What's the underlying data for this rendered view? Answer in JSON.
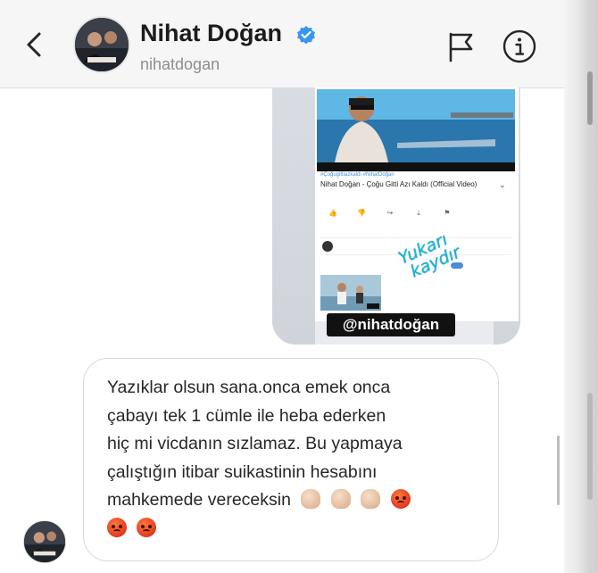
{
  "header": {
    "name": "Nihat Doğan",
    "handle": "nihatdogan",
    "verified": true,
    "icons": [
      "back-arrow-icon",
      "flag-icon",
      "info-icon",
      "verified-badge-icon"
    ]
  },
  "story": {
    "video_tags": "#Çoğugittiazkaldı #NihatDoğan",
    "video_title": "Nihat Doğan - Çoğu Gitti Azı Kaldı (Official Video)",
    "handwriting": "Yukarı kaydır",
    "mention": "@nihatdoğan"
  },
  "message": {
    "line1": "Yazıklar olsun sana.onca emek onca",
    "line2": "çabayı tek 1 cümle ile heba ederken",
    "line3": "hiç mi vicdanın sızlamaz. Bu yapmaya",
    "line4": "çalıştığın itibar suikastinin hesabını",
    "line5": "mahkemede vereceksin",
    "emojis": [
      "oncoming-fist",
      "oncoming-fist",
      "oncoming-fist",
      "angry-face",
      "angry-face",
      "angry-face"
    ]
  },
  "colors": {
    "header_bg": "#f6f6f6",
    "verified_blue": "#3897f0",
    "text": "#262626",
    "subtext": "#8e8e8e",
    "story_accent": "#1bb1d6"
  }
}
